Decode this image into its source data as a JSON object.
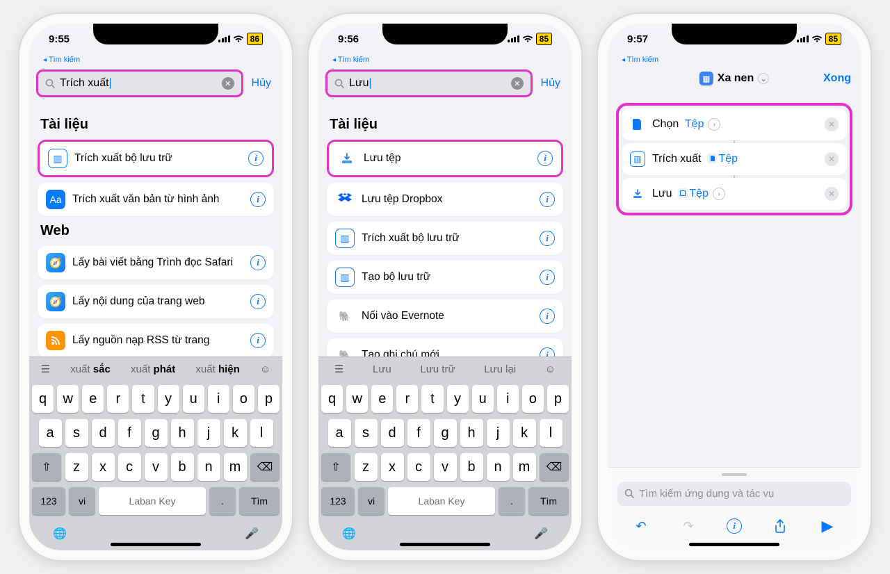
{
  "phone1": {
    "time": "9:55",
    "battery": "86",
    "back_label": "Tìm kiếm",
    "search_value": "Trích xuất",
    "cancel": "Hủy",
    "section1": "Tài liệu",
    "item1": "Trích xuất bộ lưu trữ",
    "item2": "Trích xuất văn bản từ hình ảnh",
    "section2": "Web",
    "item3": "Lấy bài viết bằng Trình đọc Safari",
    "item4": "Lấy nội dung của trang web",
    "item5": "Lấy nguồn nạp RSS từ trang",
    "suggest1_a": "xuất",
    "suggest1_b": "sắc",
    "suggest2_a": "xuất",
    "suggest2_b": "phát",
    "suggest3_a": "xuất",
    "suggest3_b": "hiện",
    "space": "Laban Key",
    "find": "Tìm",
    "k123": "123",
    "vi": "vi"
  },
  "phone2": {
    "time": "9:56",
    "battery": "85",
    "back_label": "Tìm kiếm",
    "search_value": "Lưu",
    "cancel": "Hủy",
    "section1": "Tài liệu",
    "item1": "Lưu tệp",
    "item2": "Lưu tệp Dropbox",
    "item3": "Trích xuất bộ lưu trữ",
    "item4": "Tạo bộ lưu trữ",
    "item5": "Nối vào Evernote",
    "item6": "Tạo ghi chú mới",
    "suggest1": "Lưu",
    "suggest2": "Lưu trữ",
    "suggest3": "Lưu lại",
    "space": "Laban Key",
    "find": "Tìm",
    "k123": "123",
    "vi": "vi"
  },
  "phone3": {
    "time": "9:57",
    "battery": "85",
    "back_label": "Tìm kiếm",
    "title": "Xa nen",
    "done": "Xong",
    "act1_pre": "Chọn",
    "act1_token": "Tệp",
    "act2_pre": "Trích xuất",
    "act2_token": "Tệp",
    "act3_pre": "Lưu",
    "act3_token": "Tệp",
    "search_placeholder": "Tìm kiếm ứng dụng và tác vụ"
  },
  "keys_r1": [
    "q",
    "w",
    "e",
    "r",
    "t",
    "y",
    "u",
    "i",
    "o",
    "p"
  ],
  "keys_r2": [
    "a",
    "s",
    "d",
    "f",
    "g",
    "h",
    "j",
    "k",
    "l"
  ],
  "keys_r3": [
    "z",
    "x",
    "c",
    "v",
    "b",
    "n",
    "m"
  ]
}
